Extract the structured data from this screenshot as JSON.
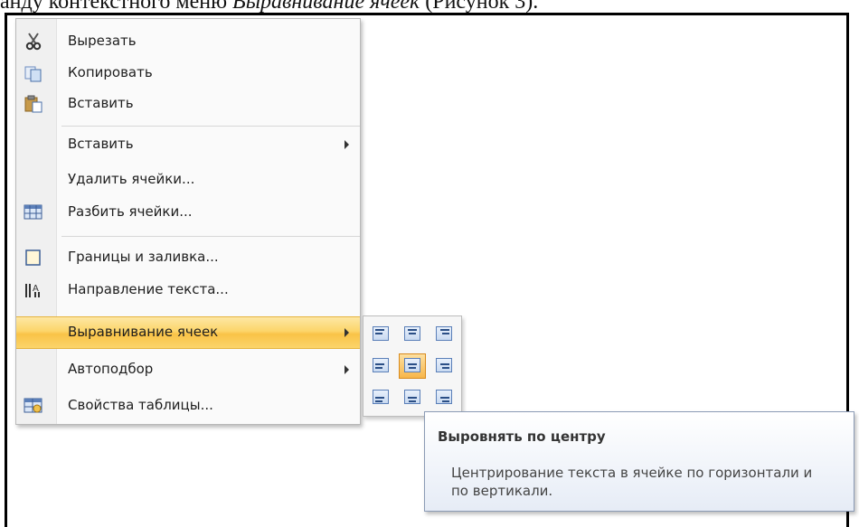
{
  "caption": {
    "prefix": "анду контекстного меню ",
    "italic": "Выравнивание ячеек",
    "suffix": " (Рисунок 3)."
  },
  "menu": {
    "items": [
      {
        "label": "Вырезать",
        "icon": "scissors-icon",
        "has_submenu": false
      },
      {
        "label": "Копировать",
        "icon": "copy-icon",
        "has_submenu": false
      },
      {
        "label": "Вставить",
        "icon": "paste-icon",
        "has_submenu": false
      },
      {
        "label": "Вставить",
        "icon": "",
        "has_submenu": true
      },
      {
        "label": "Удалить ячейки...",
        "icon": "",
        "has_submenu": false
      },
      {
        "label": "Разбить ячейки...",
        "icon": "split-cells-icon",
        "has_submenu": false
      },
      {
        "label": "Границы и заливка...",
        "icon": "borders-shading-icon",
        "has_submenu": false
      },
      {
        "label": "Направление текста...",
        "icon": "text-direction-icon",
        "has_submenu": false
      },
      {
        "label": "Выравнивание ячеек",
        "icon": "",
        "has_submenu": true,
        "highlighted": true
      },
      {
        "label": "Автоподбор",
        "icon": "",
        "has_submenu": true
      },
      {
        "label": "Свойства таблицы...",
        "icon": "table-properties-icon",
        "has_submenu": false
      }
    ]
  },
  "alignment_grid": {
    "rows": [
      "top",
      "middle",
      "bottom"
    ],
    "cols": [
      "left",
      "center",
      "right"
    ],
    "selected": "middle-center"
  },
  "tooltip": {
    "title": "Выровнять по центру",
    "body": "Центрирование текста в ячейке по горизонтали и по вертикали."
  },
  "colors": {
    "highlight": "#f9c347",
    "tooltip_border": "#8b9bb5",
    "icon_blue": "#2b4f86"
  }
}
